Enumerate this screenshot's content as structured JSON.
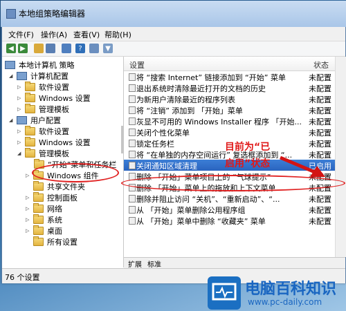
{
  "window": {
    "title": "本地组策略编辑器"
  },
  "menu": [
    "文件(F)",
    "操作(A)",
    "查看(V)",
    "帮助(H)"
  ],
  "toolbar_icons": [
    "back-arrow-icon",
    "forward-arrow-icon",
    "up-folder-icon",
    "show-tree-icon",
    "export-icon",
    "help-icon",
    "properties-icon",
    "filter-icon"
  ],
  "tree": {
    "items": [
      "本地计算机 策略",
      "计算机配置",
      "软件设置",
      "Windows 设置",
      "管理模板",
      "用户配置",
      "软件设置",
      "Windows 设置",
      "管理模板",
      "“开始”菜单和任务栏",
      "Windows 组件",
      "共享文件夹",
      "控制面板",
      "网络",
      "系统",
      "桌面",
      "所有设置"
    ]
  },
  "list": {
    "columns": {
      "setting": "设置",
      "status": "状态"
    },
    "rows": [
      {
        "name": "将 “搜索 Internet” 链接添加到 “开始” 菜单",
        "status": "未配置"
      },
      {
        "name": "退出系统时清除最近打开的文档的历史",
        "status": "未配置"
      },
      {
        "name": "为新用户清除最近的程序列表",
        "status": "未配置"
      },
      {
        "name": "将 “注销” 添加到 「开始」菜单",
        "status": "未配置"
      },
      {
        "name": "灰显不可用的 Windows Installer 程序 「开始...",
        "status": "未配置"
      },
      {
        "name": "关闭个性化菜单",
        "status": "未配置"
      },
      {
        "name": "锁定任务栏",
        "status": "未配置"
      },
      {
        "name": "将 “在单独的内存空间运行” 复选框添加到 “...",
        "status": "未配置"
      },
      {
        "name": "关闭通知区域清理",
        "status": "已启用"
      },
      {
        "name": "删除 「开始」菜单项目上的 “气球提示”",
        "status": "未配置"
      },
      {
        "name": "删除 「开始」菜单上的拖放和上下文菜单",
        "status": "未配置"
      },
      {
        "name": "删除并阻止访问 “关机”、“重新启动”、“...",
        "status": "未配置"
      },
      {
        "name": "从 「开始」菜单删除公用程序组",
        "status": "未配置"
      },
      {
        "name": "从 「开始」菜单中删除 “收藏夹” 菜单",
        "status": "未配置"
      }
    ]
  },
  "tabs": [
    "扩展",
    "标准"
  ],
  "status": {
    "text": "76 个设置"
  },
  "annotation": {
    "line1": "目前为“已",
    "line2": "启用”状态"
  },
  "colors": {
    "selection": "#2a64bf",
    "annotation": "#e01818",
    "logo": "#1a66c1"
  },
  "logo": {
    "title": "电脑百科知识",
    "url": "www.pc-daily.com"
  }
}
